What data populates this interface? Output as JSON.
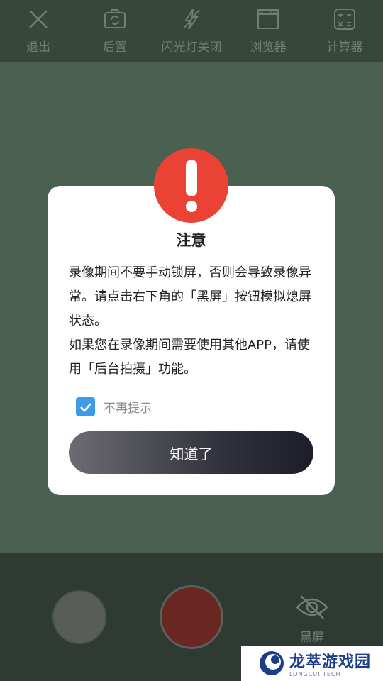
{
  "topbar": {
    "items": [
      {
        "label": "退出",
        "icon": "close-icon"
      },
      {
        "label": "后置",
        "icon": "camera-switch-icon"
      },
      {
        "label": "闪光灯关闭",
        "icon": "flash-off-icon"
      },
      {
        "label": "浏览器",
        "icon": "browser-icon"
      },
      {
        "label": "计算器",
        "icon": "calculator-icon"
      }
    ]
  },
  "bottombar": {
    "blank_label": "黑屏",
    "blank_icon": "eye-off-icon"
  },
  "dialog": {
    "title": "注意",
    "paragraphs": [
      "录像期间不要手动锁屏，否则会导致录像异常。请点击右下角的「黑屏」按钮模拟熄屏状态。",
      "如果您在录像期间需要使用其他APP，请使用「后台拍摄」功能。"
    ],
    "dont_remind_label": "不再提示",
    "dont_remind_checked": true,
    "ok_label": "知道了"
  },
  "watermark": {
    "name": "龙萃游戏园",
    "sub": "LONGCUI TECH"
  },
  "colors": {
    "alert": "#ea4335",
    "checkbox": "#3f9be8",
    "overlay_green": "#4a6151"
  }
}
